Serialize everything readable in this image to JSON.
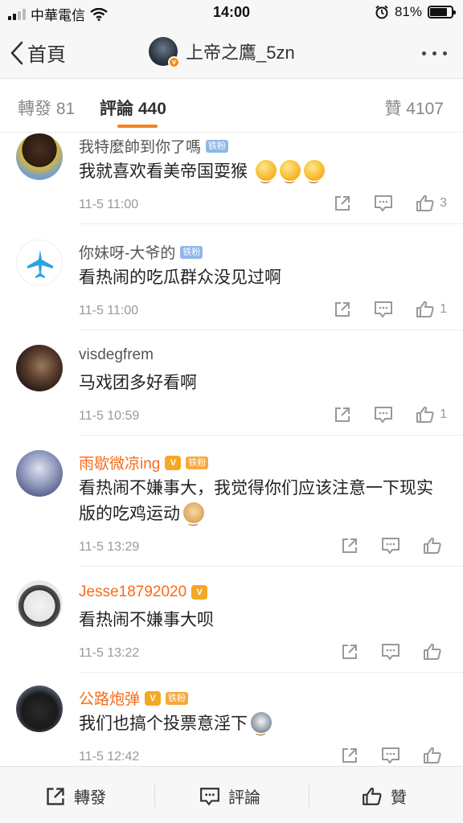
{
  "status_bar": {
    "carrier": "中華電信",
    "time": "14:00",
    "battery": "81%",
    "battery_level": 0.81
  },
  "nav": {
    "back_label": "首頁",
    "title": "上帝之鷹_5zn",
    "verified_mark": "v"
  },
  "tabs": {
    "repost": "轉發 81",
    "comments": "評論 440",
    "likes": "贊 4107"
  },
  "comments": [
    {
      "name": "我特麼帥到你了嗎",
      "badge": "铁粉",
      "text": "我就喜欢看美帝国耍猴",
      "emoji": [
        "smile-emoji",
        "smile-emoji",
        "smile-emoji"
      ],
      "time": "11-5 11:00",
      "likes": "3",
      "vip": false
    },
    {
      "name": "你妹呀-大爷的",
      "badge": "铁粉",
      "text": "看热闹的吃瓜群众没见过啊",
      "emoji": [],
      "time": "11-5 11:00",
      "likes": "1",
      "vip": false
    },
    {
      "name": "visdegfrem",
      "badge": "",
      "text": "马戏团多好看啊",
      "emoji": [],
      "time": "11-5 10:59",
      "likes": "1",
      "vip": false
    },
    {
      "name": "雨歇微凉ing",
      "badge": "铁粉",
      "crown": "V",
      "text": "看热闹不嫌事大，我觉得你们应该注意一下现实版的吃鸡运动",
      "emoji": [
        "doge-emoji"
      ],
      "time": "11-5 13:29",
      "likes": "",
      "vip": true
    },
    {
      "name": "Jesse18792020",
      "badge": "",
      "crown": "V",
      "text": "看热闹不嫌事大呗",
      "emoji": [],
      "time": "11-5 13:22",
      "likes": "",
      "vip": true
    },
    {
      "name": "公路炮弹",
      "badge": "铁粉",
      "crown": "V",
      "text": "我们也搞个投票意淫下",
      "emoji": [
        "husky-emoji"
      ],
      "time": "11-5 12:42",
      "likes": "",
      "vip": true
    }
  ],
  "bottom_bar": {
    "repost": "轉發",
    "comment": "評論",
    "like": "贊"
  },
  "colors": {
    "accent": "#f58220",
    "vip_name": "#f56b19",
    "fan_badge": "#8fb7ea"
  }
}
